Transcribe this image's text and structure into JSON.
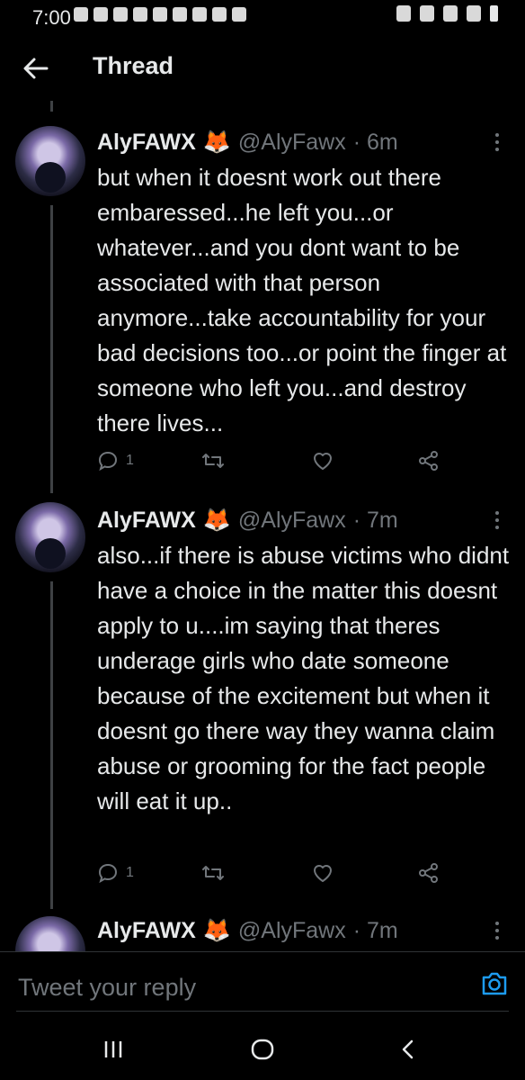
{
  "status_bar": {
    "time": "7:00",
    "left_icons": [
      "chat-icon",
      "bag-icon",
      "gmail-icon",
      "twitch-icon",
      "twitch-icon",
      "gamepad-icon",
      "gamepad-icon",
      "image-icon",
      "cloud-icon"
    ],
    "right_icons": [
      "alarm-icon",
      "mute-icon",
      "wifi-icon",
      "signal-icon",
      "battery-icon"
    ]
  },
  "header": {
    "title": "Thread",
    "back_icon": "back-arrow-icon"
  },
  "tweets": [
    {
      "name": "AlyFAWX",
      "emoji": "🦊",
      "handle": "@AlyFawx",
      "time": "· 6m",
      "text": "but when it doesnt work out there embaressed...he left you...or whatever...and you dont want to be associated with that person anymore...take accountability for your bad decisions too...or point the finger at someone who left you...and destroy there lives...",
      "reply_count": "1"
    },
    {
      "name": "AlyFAWX",
      "emoji": "🦊",
      "handle": "@AlyFawx",
      "time": "· 7m",
      "text": "also...if there is abuse victims who didnt have a choice in the matter this doesnt apply to u....im saying that theres underage girls who date someone because of the excitement but when it doesnt go there way they wanna claim abuse or grooming for the fact people will eat it up..",
      "reply_count": "1"
    },
    {
      "name": "AlyFAWX",
      "emoji": "🦊",
      "handle": "@AlyFawx",
      "time": "· 7m"
    }
  ],
  "reply": {
    "placeholder": "Tweet your reply"
  },
  "colors": {
    "background": "#000000",
    "text": "#e7e9ea",
    "muted": "#71767b",
    "accent": "#1d9bf0"
  }
}
